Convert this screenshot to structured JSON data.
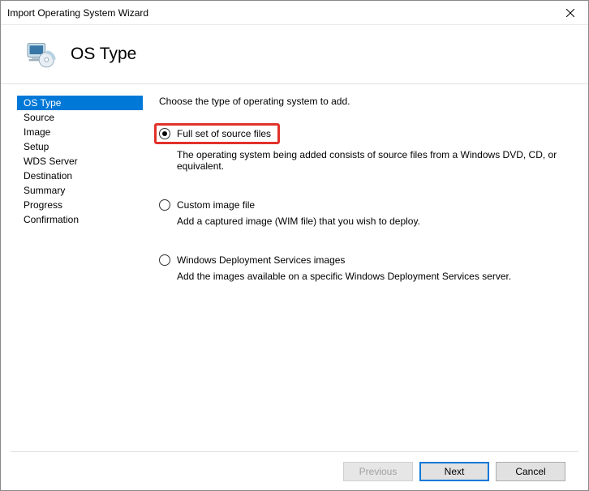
{
  "window": {
    "title": "Import Operating System Wizard"
  },
  "header": {
    "title": "OS Type"
  },
  "sidebar": {
    "items": [
      {
        "label": "OS Type",
        "active": true
      },
      {
        "label": "Source",
        "active": false
      },
      {
        "label": "Image",
        "active": false
      },
      {
        "label": "Setup",
        "active": false
      },
      {
        "label": "WDS Server",
        "active": false
      },
      {
        "label": "Destination",
        "active": false
      },
      {
        "label": "Summary",
        "active": false
      },
      {
        "label": "Progress",
        "active": false
      },
      {
        "label": "Confirmation",
        "active": false
      }
    ]
  },
  "content": {
    "prompt": "Choose the type of operating system to add.",
    "options": [
      {
        "label": "Full set of source files",
        "desc": "The operating system being added consists of source files from a Windows DVD, CD, or equivalent.",
        "selected": true,
        "highlight": true
      },
      {
        "label": "Custom image file",
        "desc": "Add a captured image (WIM file) that you wish to deploy.",
        "selected": false,
        "highlight": false
      },
      {
        "label": "Windows Deployment Services images",
        "desc": "Add the images available on a specific Windows Deployment Services server.",
        "selected": false,
        "highlight": false
      }
    ]
  },
  "footer": {
    "previous": "Previous",
    "next": "Next",
    "cancel": "Cancel"
  }
}
